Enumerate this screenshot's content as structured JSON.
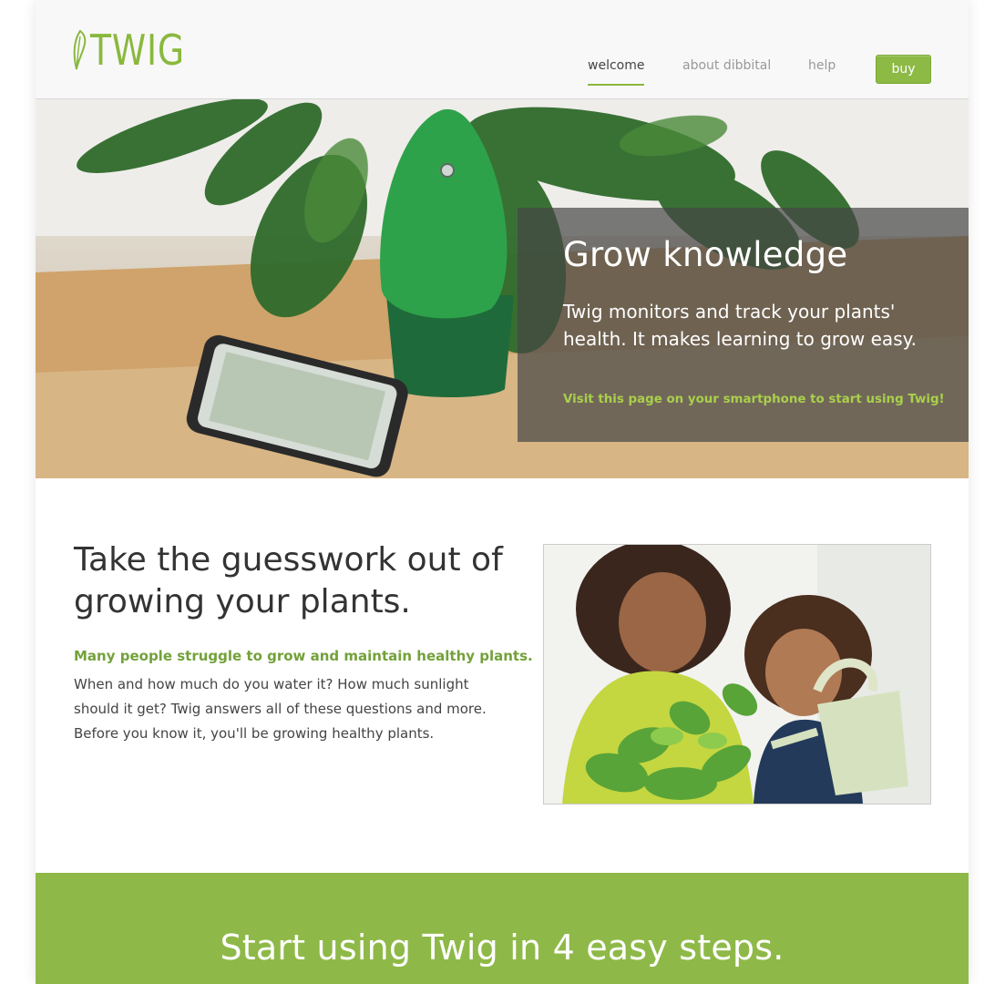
{
  "brand": {
    "name": "TWIG",
    "accent": "#8ab83e"
  },
  "nav": {
    "items": [
      {
        "label": "welcome",
        "active": true
      },
      {
        "label": "about dibbital",
        "active": false
      },
      {
        "label": "help",
        "active": false
      }
    ],
    "buy_label": "buy"
  },
  "hero": {
    "title": "Grow knowledge",
    "body": "Twig monitors and track your plants' health. It makes learning to grow easy.",
    "note": "Visit this page on your smartphone to start using Twig!"
  },
  "intro": {
    "heading": "Take the guesswork out of growing your plants.",
    "lead": "Many people struggle to grow and maintain healthy plants.",
    "body": "When and how much do you water it? How much sunlight should it get? Twig answers all of these questions and more. Before you know it, you'll be growing healthy plants."
  },
  "steps": {
    "title": "Start using Twig in 4 easy steps."
  },
  "colors": {
    "green_band": "#8eb948",
    "note_green": "#a9cf4c",
    "lead_green": "#73a13a"
  }
}
